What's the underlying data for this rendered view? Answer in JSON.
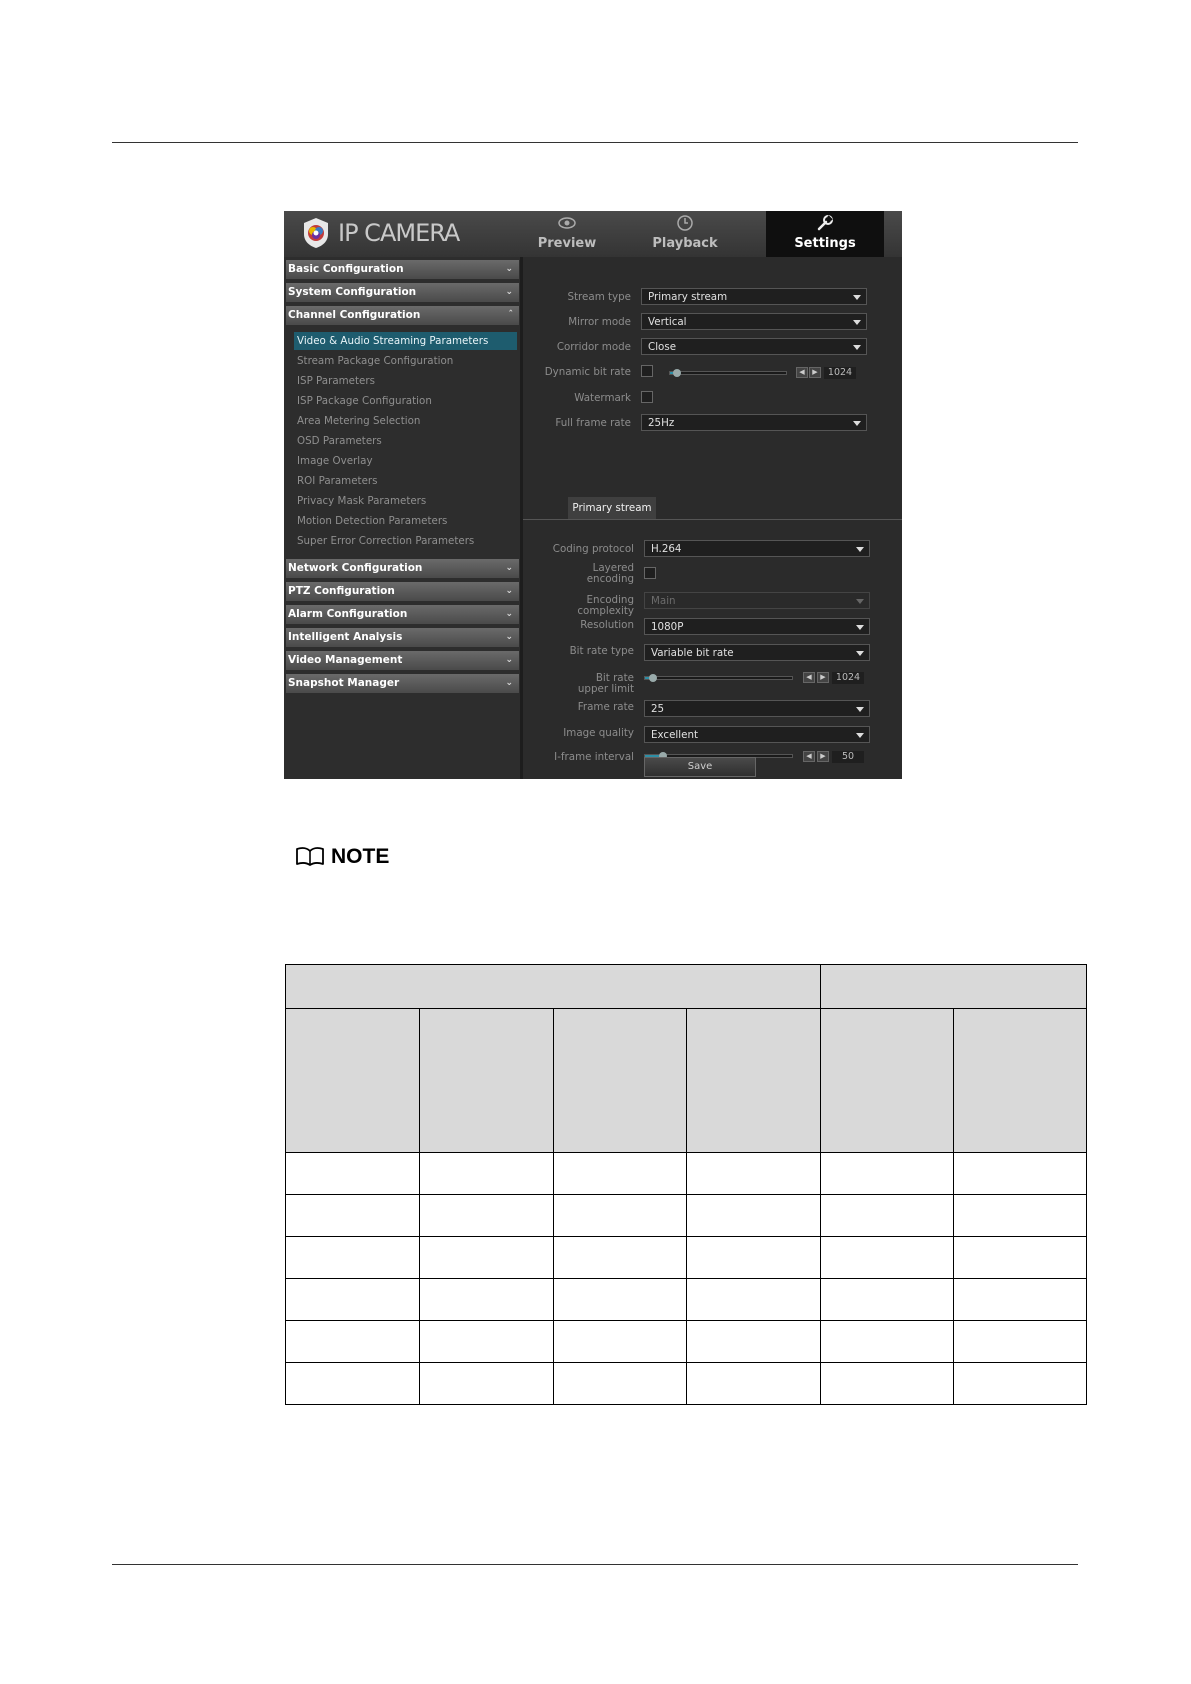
{
  "camera_ui": {
    "logo_text": "IP CAMERA",
    "tabs": [
      {
        "label": "Preview",
        "icon": "eye-icon"
      },
      {
        "label": "Playback",
        "icon": "clock-icon"
      },
      {
        "label": "Settings",
        "icon": "wrench-icon"
      }
    ],
    "sidebar": {
      "categories": [
        "Basic Configuration",
        "System Configuration",
        "Channel Configuration",
        "Network Configuration",
        "PTZ Configuration",
        "Alarm Configuration",
        "Intelligent Analysis",
        "Video Management",
        "Snapshot Manager"
      ],
      "channel_items": [
        "Video & Audio Streaming Parameters",
        "Stream Package Configuration",
        "ISP Parameters",
        "ISP Package Configuration",
        "Area Metering Selection",
        "OSD Parameters",
        "Image Overlay",
        "ROI Parameters",
        "Privacy Mask Parameters",
        "Motion Detection Parameters",
        "Super Error Correction Parameters"
      ]
    },
    "form": {
      "stream_type": {
        "label": "Stream type",
        "value": "Primary stream"
      },
      "mirror_mode": {
        "label": "Mirror mode",
        "value": "Vertical"
      },
      "corridor_mode": {
        "label": "Corridor mode",
        "value": "Close"
      },
      "dynamic_bit_rate": {
        "label": "Dynamic bit rate",
        "value": "1024",
        "level": 0.05
      },
      "watermark": {
        "label": "Watermark"
      },
      "full_frame_rate": {
        "label": "Full frame rate",
        "value": "25Hz"
      },
      "stream_tab": "Primary stream",
      "coding_protocol": {
        "label": "Coding protocol",
        "value": "H.264"
      },
      "layered_encoding": {
        "label_1": "Layered",
        "label_2": "encoding"
      },
      "encoding_complexity": {
        "label_1": "Encoding",
        "label_2": "complexity",
        "value": "Main"
      },
      "resolution": {
        "label": "Resolution",
        "value": "1080P"
      },
      "bit_rate_type": {
        "label": "Bit rate type",
        "value": "Variable bit rate"
      },
      "bit_rate_upper_limit": {
        "label_1": "Bit rate",
        "label_2": "upper limit",
        "value": "1024",
        "level": 0.05
      },
      "frame_rate": {
        "label": "Frame rate",
        "value": "25"
      },
      "image_quality": {
        "label": "Image quality",
        "value": "Excellent"
      },
      "i_frame_interval": {
        "label": "I-frame interval",
        "value": "50",
        "level": 0.12
      },
      "save_label": "Save"
    }
  },
  "note": {
    "label": "NOTE",
    "icon": "book-icon"
  }
}
